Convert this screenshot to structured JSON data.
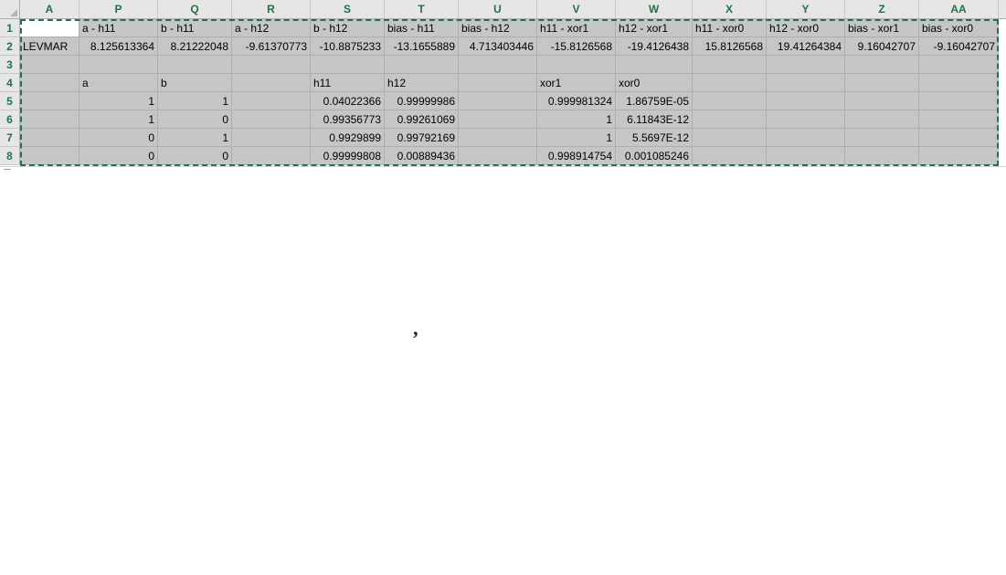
{
  "columns": [
    "A",
    "P",
    "Q",
    "R",
    "S",
    "T",
    "U",
    "V",
    "W",
    "X",
    "Y",
    "Z",
    "AA"
  ],
  "row_numbers": [
    "1",
    "2",
    "3",
    "4",
    "5",
    "6",
    "7",
    "8"
  ],
  "rows": [
    [
      "",
      "a - h11",
      "b - h11",
      "a - h12",
      "b - h12",
      "bias - h11",
      "bias - h12",
      "h11 - xor1",
      "h12 - xor1",
      "h11 - xor0",
      "h12 - xor0",
      "bias - xor1",
      "bias - xor0"
    ],
    [
      "LEVMAR",
      "8.125613364",
      "8.21222048",
      "-9.61370773",
      "-10.8875233",
      "-13.1655889",
      "4.713403446",
      "-15.8126568",
      "-19.4126438",
      "15.8126568",
      "19.41264384",
      "9.16042707",
      "-9.16042707"
    ],
    [
      "",
      "",
      "",
      "",
      "",
      "",
      "",
      "",
      "",
      "",
      "",
      "",
      ""
    ],
    [
      "",
      "a",
      "b",
      "",
      "h11",
      "h12",
      "",
      "xor1",
      "xor0",
      "",
      "",
      "",
      ""
    ],
    [
      "",
      "1",
      "1",
      "",
      "0.04022366",
      "0.99999986",
      "",
      "0.999981324",
      "1.86759E-05",
      "",
      "",
      "",
      ""
    ],
    [
      "",
      "1",
      "0",
      "",
      "0.99356773",
      "0.99261069",
      "",
      "1",
      "6.11843E-12",
      "",
      "",
      "",
      ""
    ],
    [
      "",
      "0",
      "1",
      "",
      "0.9929899",
      "0.99792169",
      "",
      "1",
      "5.5697E-12",
      "",
      "",
      "",
      ""
    ],
    [
      "",
      "0",
      "0",
      "",
      "0.99999808",
      "0.00889436",
      "",
      "0.998914754",
      "0.001085246",
      "",
      "",
      "",
      ""
    ]
  ],
  "stray_mark": "’",
  "colors": {
    "header_text": "#217346",
    "selection_fill": "#c6c6c6",
    "selection_border": "#217346"
  }
}
